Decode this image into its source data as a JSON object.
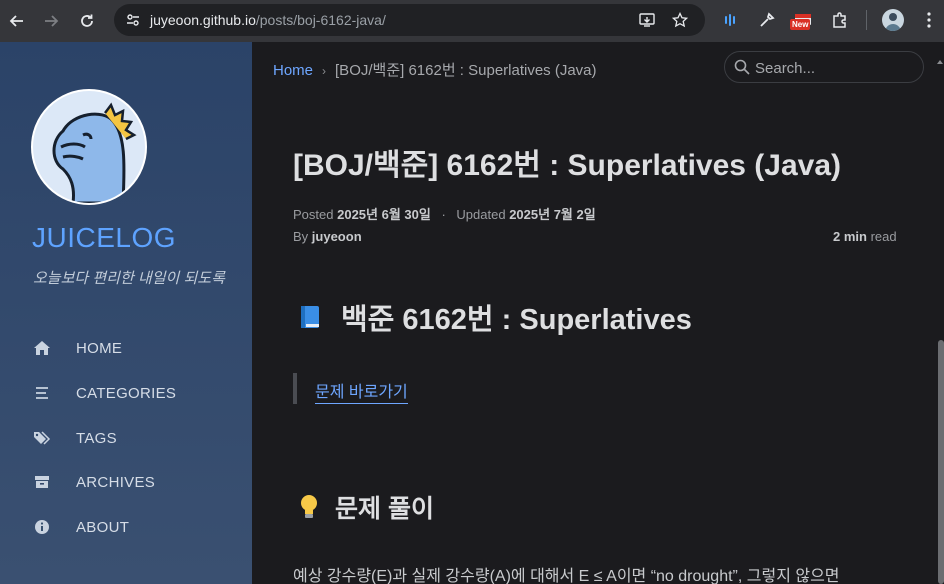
{
  "browser": {
    "url_host": "juyeoon.github.io",
    "url_path": "/posts/boj-6162-java/",
    "new_badge": "New"
  },
  "sidebar": {
    "title": "JUICELOG",
    "subtitle": "오늘보다 편리한 내일이 되도록",
    "items": [
      {
        "label": "HOME",
        "icon": "home-icon"
      },
      {
        "label": "CATEGORIES",
        "icon": "list-icon"
      },
      {
        "label": "TAGS",
        "icon": "tags-icon"
      },
      {
        "label": "ARCHIVES",
        "icon": "archive-icon"
      },
      {
        "label": "ABOUT",
        "icon": "info-icon"
      }
    ]
  },
  "topbar": {
    "breadcrumb_home": "Home",
    "breadcrumb_current": "[BOJ/백준] 6162번 : Superlatives (Java)",
    "search_placeholder": "Search..."
  },
  "post": {
    "title": "[BOJ/백준] 6162번 : Superlatives (Java)",
    "posted_label": "Posted",
    "posted_date": "2025년 6월 30일",
    "updated_label": "Updated",
    "updated_date": "2025년 7월 2일",
    "by_label": "By",
    "author": "juyeoon",
    "read_time": "2 min",
    "read_label": "read",
    "h2": "백준 6162번 : Superlatives",
    "quote_link": "문제 바로가기",
    "h3": "문제 풀이",
    "paragraph": "예상 강수량(E)과 실제 강수량(A)에 대해서 E ≤ A이면 “no drought”, 그렇지 않으면"
  },
  "colors": {
    "accent": "#6ea6ff",
    "sidebar_bg": "#2b4368",
    "main_bg": "#1b1b1e",
    "browser_bar": "#35363a"
  }
}
